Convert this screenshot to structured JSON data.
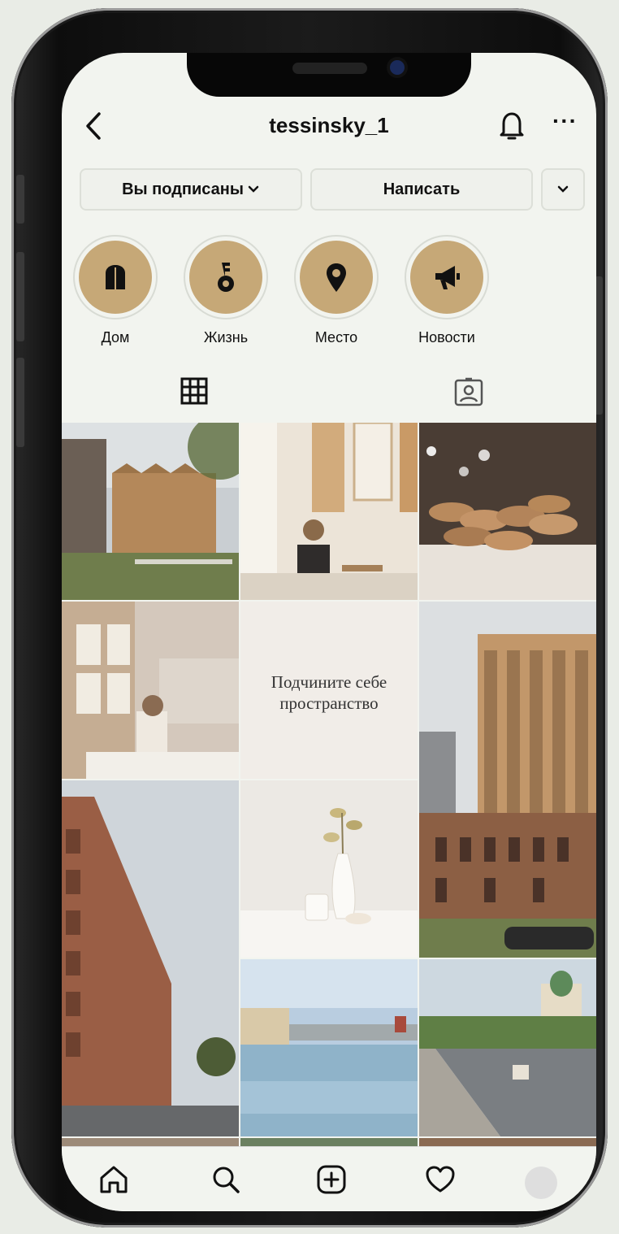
{
  "profile": {
    "username": "tessinsky_1"
  },
  "buttons": {
    "following": "Вы подписаны",
    "message": "Написать"
  },
  "highlights": [
    {
      "label": "Дом",
      "icon": "door-icon"
    },
    {
      "label": "Жизнь",
      "icon": "key-icon"
    },
    {
      "label": "Место",
      "icon": "location-pin-icon"
    },
    {
      "label": "Новости",
      "icon": "megaphone-icon"
    }
  ],
  "grid": {
    "caption_line1": "Подчините себе",
    "caption_line2": "пространство"
  },
  "colors": {
    "highlight_fill": "#c6a877",
    "background": "#f2f4ef"
  }
}
